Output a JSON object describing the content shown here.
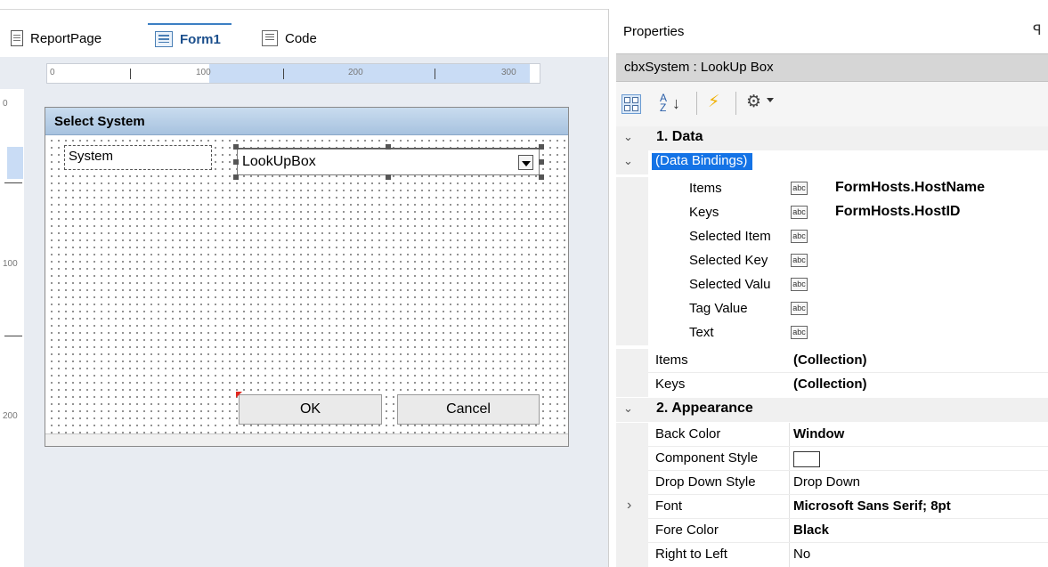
{
  "tabs": [
    {
      "label": "ReportPage",
      "icon": "report-page-icon",
      "active": false
    },
    {
      "label": "Form1",
      "icon": "form-icon",
      "active": true
    },
    {
      "label": "Code",
      "icon": "code-icon",
      "active": false
    }
  ],
  "ruler": {
    "h_labels": [
      "0",
      "100",
      "200",
      "300"
    ],
    "v_labels": [
      "0",
      "100",
      "200"
    ]
  },
  "form": {
    "title": "Select System",
    "label_text": "System",
    "combo_text": "LookUpBox",
    "ok_label": "OK",
    "cancel_label": "Cancel"
  },
  "properties": {
    "title": "Properties",
    "pin_glyph": "ꟼ",
    "object": "cbxSystem : LookUp Box",
    "az_top": "A",
    "az_bottom": "Z",
    "sort_arrow": "↓",
    "event_glyph": "⚡",
    "gear_glyph": "⚙",
    "abc": "abc",
    "categories": {
      "data": "1. Data",
      "appearance": "2. Appearance"
    },
    "data_bindings_label": "(Data Bindings)",
    "bindings": [
      {
        "name": "Items",
        "value": "FormHosts.HostName"
      },
      {
        "name": "Keys",
        "value": "FormHosts.HostID"
      },
      {
        "name": "Selected Item",
        "value": ""
      },
      {
        "name": "Selected Key",
        "value": ""
      },
      {
        "name": "Selected Valu",
        "value": ""
      },
      {
        "name": "Tag Value",
        "value": ""
      },
      {
        "name": "Text",
        "value": ""
      }
    ],
    "data_props": [
      {
        "name": "Items",
        "value": "(Collection)"
      },
      {
        "name": "Keys",
        "value": "(Collection)"
      }
    ],
    "appearance_props": [
      {
        "name": "Back Color",
        "value": "Window",
        "bold": true
      },
      {
        "name": "Component Style",
        "value": "",
        "swatch": "#ffffff"
      },
      {
        "name": "Drop Down Style",
        "value": "Drop Down",
        "bold": false
      },
      {
        "name": "Font",
        "value": "Microsoft Sans Serif; 8pt",
        "bold": true,
        "expandable": true
      },
      {
        "name": "Fore Color",
        "value": "Black",
        "bold": true
      },
      {
        "name": "Right to Left",
        "value": "No",
        "bold": false
      }
    ],
    "chevrons": {
      "expanded": "⌄",
      "collapsed": "›"
    }
  },
  "colors": {
    "accent": "#3c7fc3",
    "selection": "#1473e6",
    "form_title_bg": "#b6cde6",
    "designer_bg": "#e8ecf2"
  }
}
